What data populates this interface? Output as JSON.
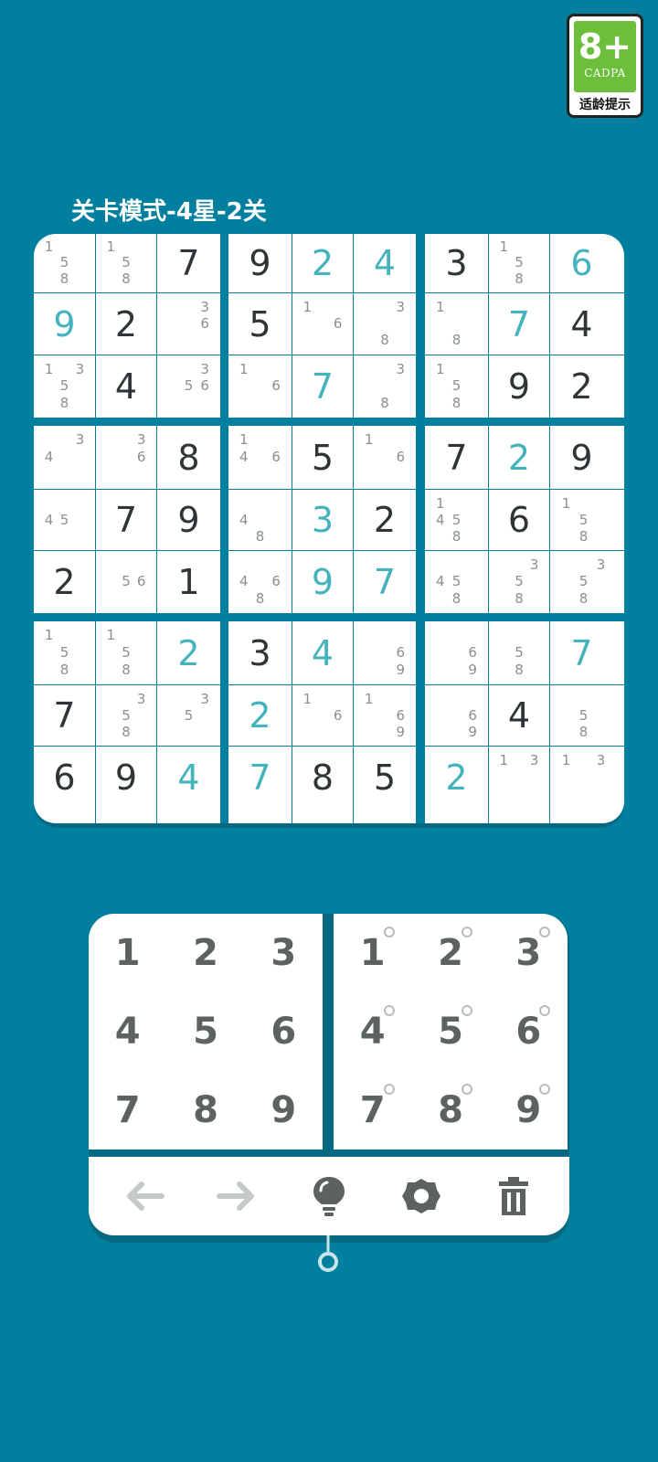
{
  "badge": {
    "age": "8+",
    "org": "CADPA",
    "note": "适龄提示"
  },
  "level_title": "关卡模式-4星-2关",
  "board": [
    [
      {
        "v": "",
        "n": [
          1,
          5,
          8
        ]
      },
      {
        "v": "",
        "n": [
          1,
          5,
          8
        ]
      },
      {
        "v": "7",
        "t": "g"
      },
      {
        "v": "9",
        "t": "g"
      },
      {
        "v": "2",
        "t": "e"
      },
      {
        "v": "4",
        "t": "e"
      },
      {
        "v": "3",
        "t": "g"
      },
      {
        "v": "",
        "n": [
          1,
          5,
          8
        ]
      },
      {
        "v": "6",
        "t": "e"
      }
    ],
    [
      {
        "v": "9",
        "t": "e"
      },
      {
        "v": "2",
        "t": "g"
      },
      {
        "v": "",
        "n": [
          3,
          6
        ]
      },
      {
        "v": "5",
        "t": "g"
      },
      {
        "v": "",
        "n": [
          1,
          6
        ]
      },
      {
        "v": "",
        "n": [
          3,
          8
        ]
      },
      {
        "v": "",
        "n": [
          1,
          8
        ]
      },
      {
        "v": "7",
        "t": "e"
      },
      {
        "v": "4",
        "t": "g"
      }
    ],
    [
      {
        "v": "",
        "n": [
          1,
          3,
          5,
          8
        ]
      },
      {
        "v": "4",
        "t": "g"
      },
      {
        "v": "",
        "n": [
          3,
          5,
          6
        ]
      },
      {
        "v": "",
        "n": [
          1,
          6
        ]
      },
      {
        "v": "7",
        "t": "e"
      },
      {
        "v": "",
        "n": [
          3,
          8
        ]
      },
      {
        "v": "",
        "n": [
          1,
          5,
          8
        ]
      },
      {
        "v": "9",
        "t": "g"
      },
      {
        "v": "2",
        "t": "g"
      }
    ],
    [
      {
        "v": "",
        "n": [
          3,
          4
        ]
      },
      {
        "v": "",
        "n": [
          3,
          6
        ]
      },
      {
        "v": "8",
        "t": "g"
      },
      {
        "v": "",
        "n": [
          1,
          4,
          6
        ]
      },
      {
        "v": "5",
        "t": "g"
      },
      {
        "v": "",
        "n": [
          1,
          6
        ]
      },
      {
        "v": "7",
        "t": "g"
      },
      {
        "v": "2",
        "t": "e"
      },
      {
        "v": "9",
        "t": "g"
      }
    ],
    [
      {
        "v": "",
        "n": [
          4,
          5
        ]
      },
      {
        "v": "7",
        "t": "g"
      },
      {
        "v": "9",
        "t": "g"
      },
      {
        "v": "",
        "n": [
          4,
          8
        ]
      },
      {
        "v": "3",
        "t": "e"
      },
      {
        "v": "2",
        "t": "g"
      },
      {
        "v": "",
        "n": [
          1,
          4,
          5,
          8
        ]
      },
      {
        "v": "6",
        "t": "g"
      },
      {
        "v": "",
        "n": [
          1,
          5,
          8
        ]
      }
    ],
    [
      {
        "v": "2",
        "t": "g"
      },
      {
        "v": "",
        "n": [
          5,
          6
        ]
      },
      {
        "v": "1",
        "t": "g"
      },
      {
        "v": "",
        "n": [
          4,
          6,
          8
        ]
      },
      {
        "v": "9",
        "t": "e"
      },
      {
        "v": "7",
        "t": "e"
      },
      {
        "v": "",
        "n": [
          4,
          5,
          8
        ]
      },
      {
        "v": "",
        "n": [
          3,
          5,
          8
        ]
      },
      {
        "v": "",
        "n": [
          3,
          5,
          8
        ]
      }
    ],
    [
      {
        "v": "",
        "n": [
          1,
          5,
          8
        ]
      },
      {
        "v": "",
        "n": [
          1,
          5,
          8
        ]
      },
      {
        "v": "2",
        "t": "e"
      },
      {
        "v": "3",
        "t": "g"
      },
      {
        "v": "4",
        "t": "e"
      },
      {
        "v": "",
        "n": [
          6,
          9
        ]
      },
      {
        "v": "",
        "n": [
          6,
          9
        ]
      },
      {
        "v": "",
        "n": [
          5,
          8
        ]
      },
      {
        "v": "7",
        "t": "e"
      }
    ],
    [
      {
        "v": "7",
        "t": "g"
      },
      {
        "v": "",
        "n": [
          3,
          5,
          8
        ]
      },
      {
        "v": "",
        "n": [
          3,
          5
        ]
      },
      {
        "v": "2",
        "t": "e"
      },
      {
        "v": "",
        "n": [
          1,
          6
        ]
      },
      {
        "v": "",
        "n": [
          1,
          6,
          9
        ]
      },
      {
        "v": "",
        "n": [
          6,
          9
        ]
      },
      {
        "v": "4",
        "t": "g"
      },
      {
        "v": "",
        "n": [
          5,
          8
        ]
      }
    ],
    [
      {
        "v": "6",
        "t": "g"
      },
      {
        "v": "9",
        "t": "g"
      },
      {
        "v": "4",
        "t": "e"
      },
      {
        "v": "7",
        "t": "e"
      },
      {
        "v": "8",
        "t": "g"
      },
      {
        "v": "5",
        "t": "g"
      },
      {
        "v": "2",
        "t": "e"
      },
      {
        "v": "",
        "n": [
          1,
          3
        ]
      },
      {
        "v": "",
        "n": [
          1,
          3
        ]
      }
    ]
  ],
  "number_pad": [
    "1",
    "2",
    "3",
    "4",
    "5",
    "6",
    "7",
    "8",
    "9"
  ],
  "note_pad": [
    "1",
    "2",
    "3",
    "4",
    "5",
    "6",
    "7",
    "8",
    "9"
  ],
  "toolbar": [
    {
      "name": "undo-icon",
      "enabled": false
    },
    {
      "name": "redo-icon",
      "enabled": false
    },
    {
      "name": "hint-bulb-icon",
      "enabled": true
    },
    {
      "name": "settings-gear-icon",
      "enabled": true
    },
    {
      "name": "delete-trash-icon",
      "enabled": true
    }
  ],
  "colors": {
    "background": "#00809e",
    "given": "#2f3537",
    "entered": "#45b3bd",
    "note": "#8a8f91",
    "pad_digit": "#5c6162",
    "disabled": "#c5c9ca"
  }
}
